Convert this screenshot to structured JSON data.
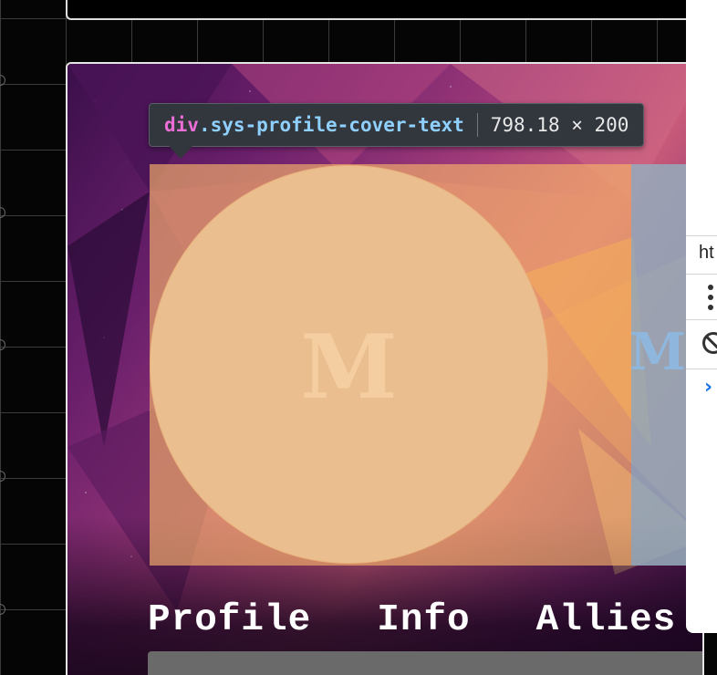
{
  "inspector_tooltip": {
    "tag": "div",
    "class_name": ".sys-profile-cover-text",
    "dimensions": "798.18 × 200"
  },
  "profile_card": {
    "avatar_initial": "M",
    "cover_name_partial": "Me",
    "tabs": [
      {
        "label": "Profile"
      },
      {
        "label": "Info"
      },
      {
        "label": "Allies"
      }
    ]
  },
  "devtools_panel": {
    "url_partial": "ht",
    "more_icon": "kebab-menu-icon",
    "clear_icon": "clear-console-icon",
    "prompt_icon": "console-prompt-chevron-icon"
  },
  "colors": {
    "highlight_content": "#f6b26b",
    "highlight_padding": "#6fa8dc",
    "tooltip_background": "#32363d",
    "tooltip_tag": "#ea6ed6",
    "tooltip_class": "#8fd0ff"
  }
}
